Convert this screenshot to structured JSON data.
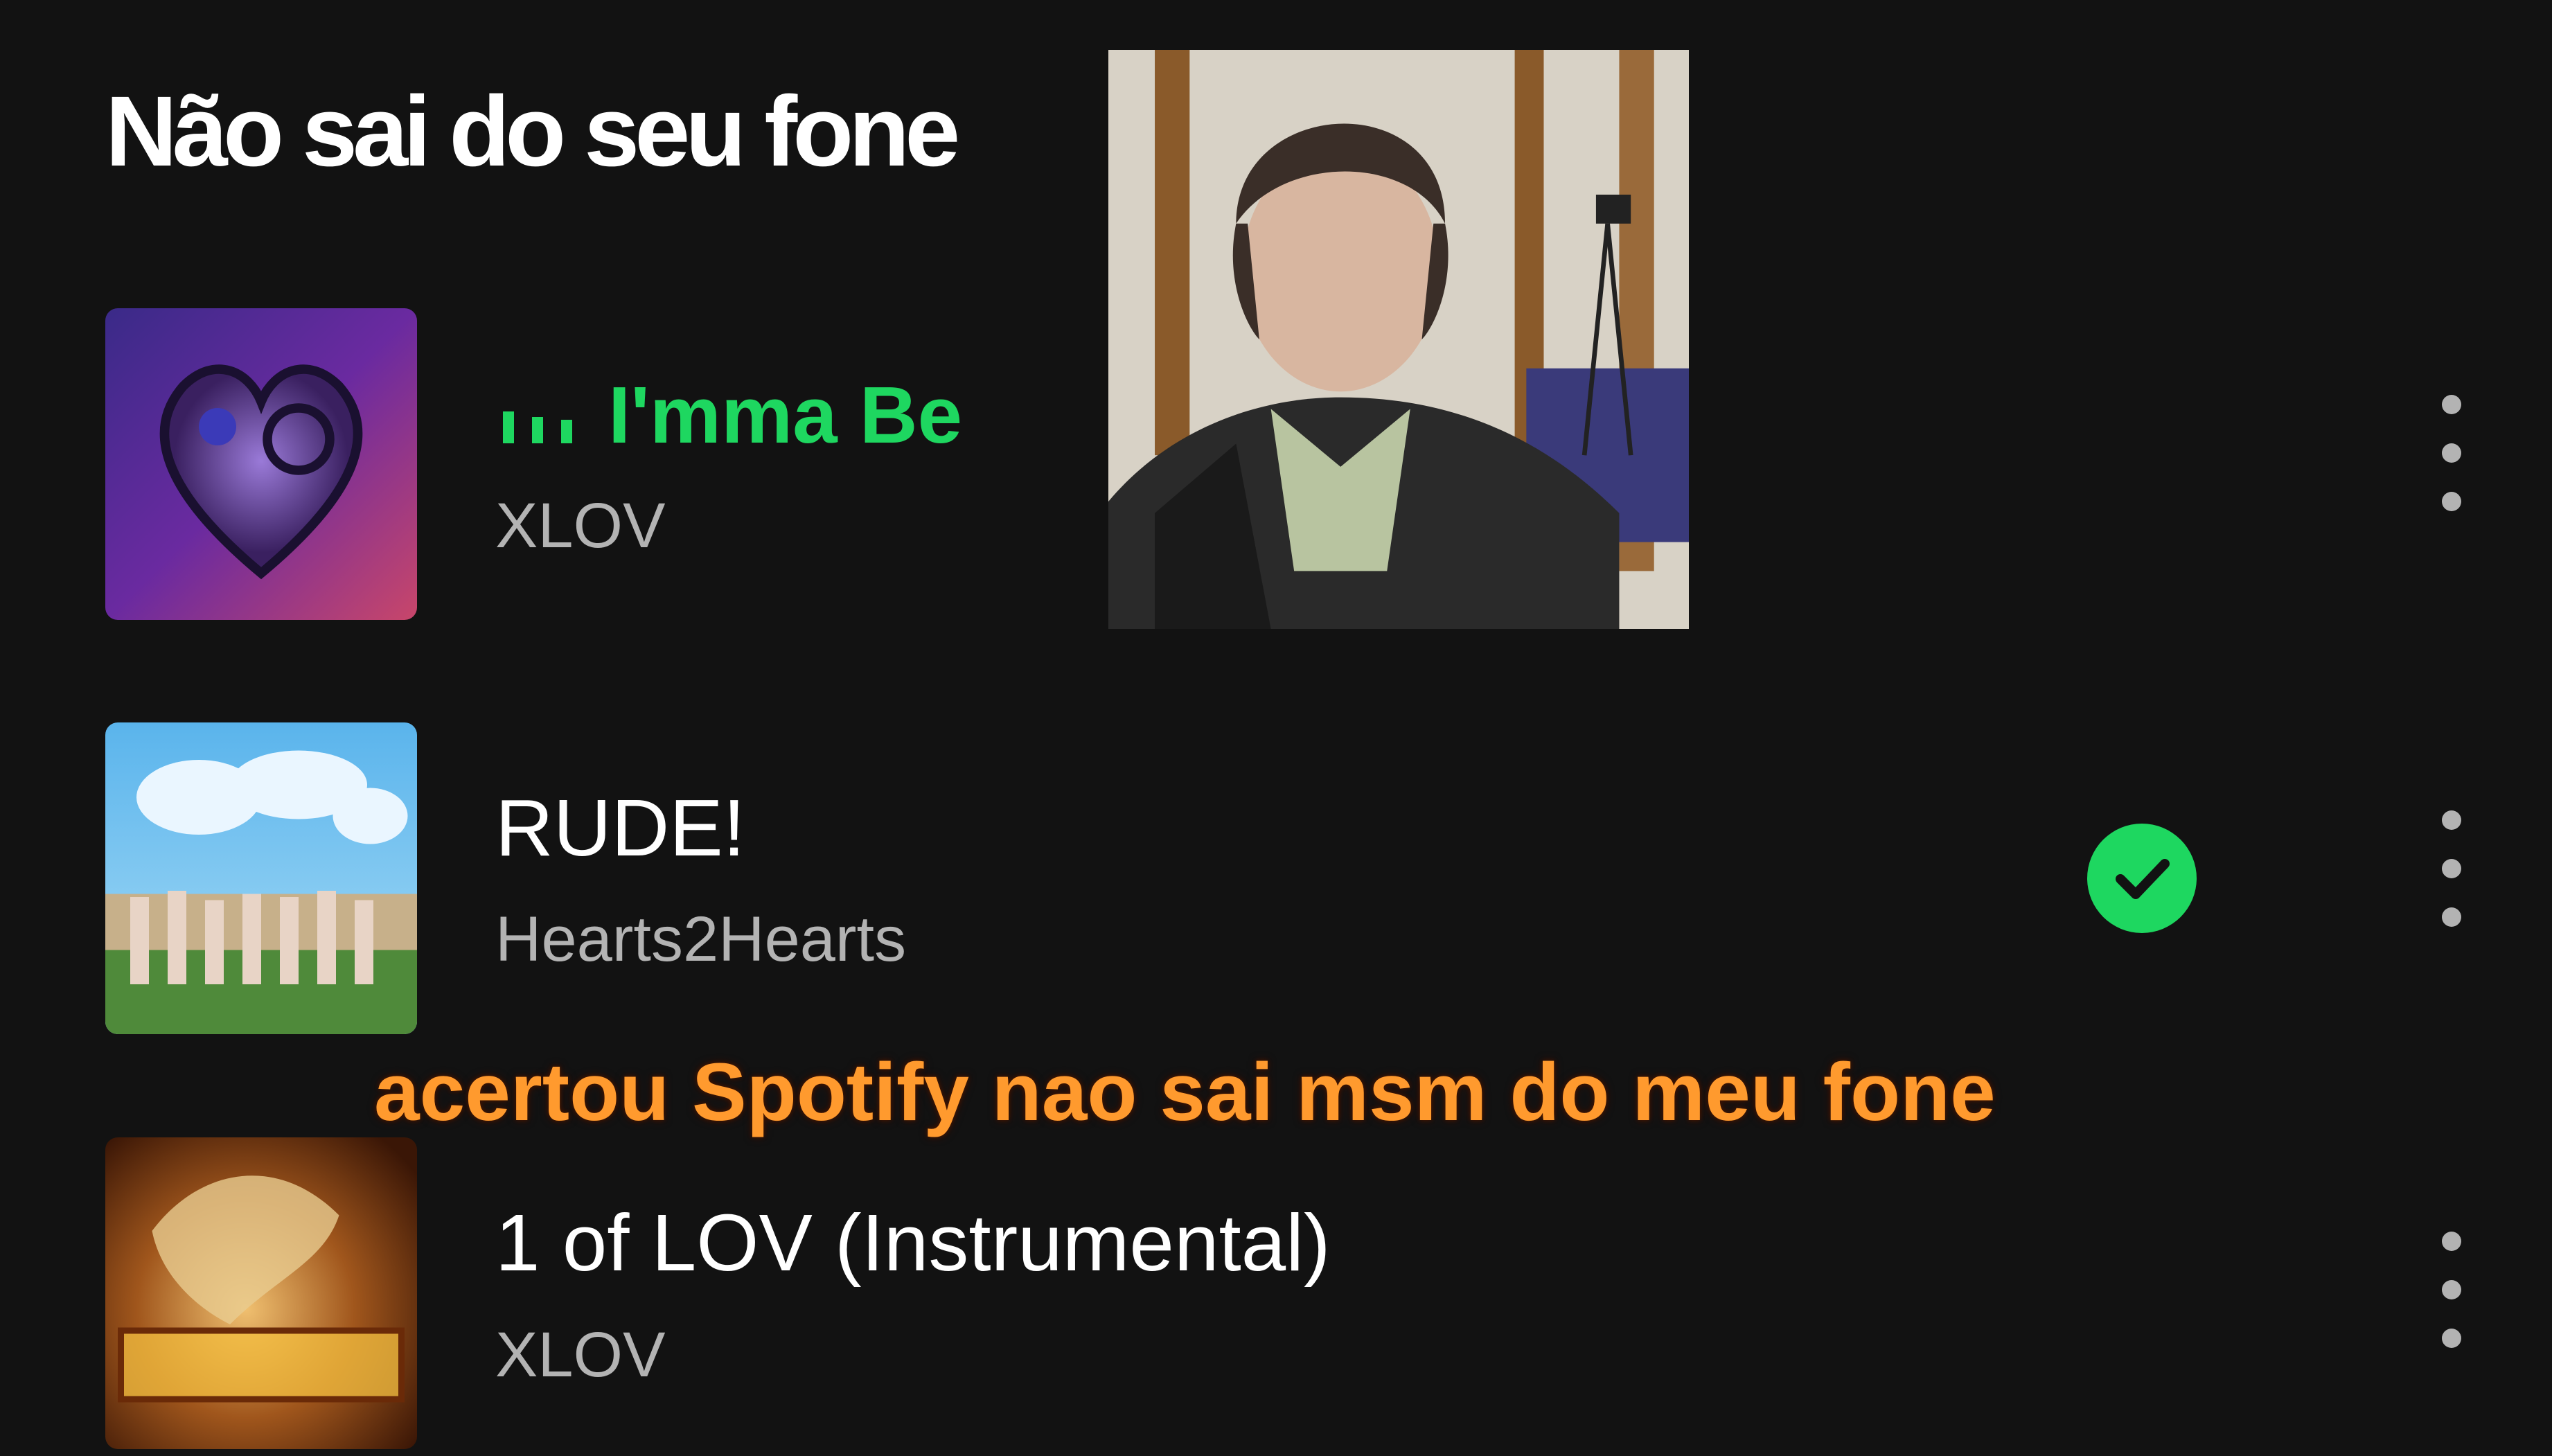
{
  "section": {
    "title": "Não sai do seu fone"
  },
  "tracks": [
    {
      "title": "I'mma Be",
      "artist": "XLOV",
      "playing": true,
      "icons": [
        "equalizer-icon",
        "more-vert-icon"
      ]
    },
    {
      "title": "RUDE!",
      "artist": "Hearts2Hearts",
      "playing": false,
      "saved": true,
      "icons": [
        "check-circle-icon",
        "more-vert-icon"
      ]
    },
    {
      "title": "1 of LOV (Instrumental)",
      "artist": "XLOV",
      "playing": false,
      "icons": [
        "more-vert-icon"
      ]
    }
  ],
  "caption": "acertou Spotify nao sai msm do meu fone",
  "colors": {
    "background": "#121212",
    "accent": "#1ed760",
    "secondary_text": "#b3b3b3",
    "caption": "#ff9a2e"
  }
}
